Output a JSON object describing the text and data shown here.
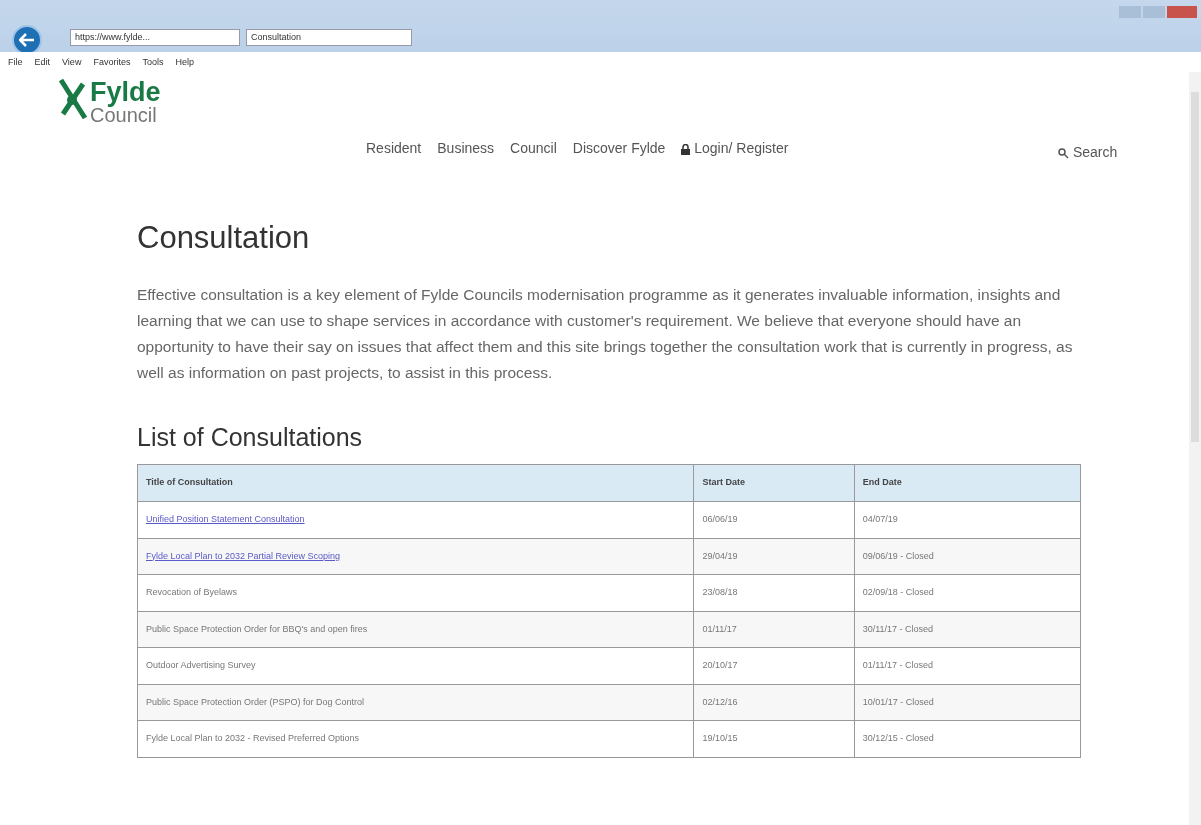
{
  "browser": {
    "address": "https://www.fylde...",
    "tab_title": "Consultation",
    "menu": [
      "File",
      "Edit",
      "View",
      "Favorites",
      "Tools",
      "Help"
    ]
  },
  "logo": {
    "name": "Fylde",
    "subtitle": "Council"
  },
  "nav": [
    {
      "label": "Resident",
      "kind": "link"
    },
    {
      "label": "Business",
      "kind": "link"
    },
    {
      "label": "Council",
      "kind": "link"
    },
    {
      "label": "Discover Fylde",
      "kind": "link"
    },
    {
      "label": "Login/ Register",
      "kind": "login"
    }
  ],
  "search": {
    "label": "Search"
  },
  "title": "Consultation",
  "intro": "Effective consultation is a key element of Fylde Councils modernisation programme as it generates invaluable information, insights and learning that we can use to shape services in accordance with customer's requirement. We believe that everyone should have an opportunity to have their say on issues that affect them and this site brings together the consultation work that is currently in progress, as well as information on past projects, to assist in this process.",
  "list_heading": "List of Consultations",
  "table": {
    "columns": [
      "Title of Consultation",
      "Start Date",
      "End Date"
    ],
    "rows": [
      {
        "title": "Unified Position Statement Consultation",
        "link": true,
        "start": "06/06/19",
        "end": "04/07/19"
      },
      {
        "title": "Fylde Local Plan to 2032 Partial Review Scoping",
        "link": true,
        "start": "29/04/19",
        "end": "09/06/19 - Closed"
      },
      {
        "title": "Revocation of Byelaws",
        "link": false,
        "start": "23/08/18",
        "end": "02/09/18 - Closed"
      },
      {
        "title": "Public Space Protection Order for BBQ's and open fires",
        "link": false,
        "start": "01/11/17",
        "end": "30/11/17 - Closed"
      },
      {
        "title": "Outdoor Advertising Survey",
        "link": false,
        "start": "20/10/17",
        "end": "01/11/17 - Closed"
      },
      {
        "title": "Public Space Protection Order (PSPO) for Dog Control",
        "link": false,
        "start": "02/12/16",
        "end": "10/01/17 - Closed"
      },
      {
        "title": "Fylde Local Plan to 2032 - Revised Preferred Options",
        "link": false,
        "start": "19/10/15",
        "end": "30/12/15 - Closed"
      }
    ]
  }
}
